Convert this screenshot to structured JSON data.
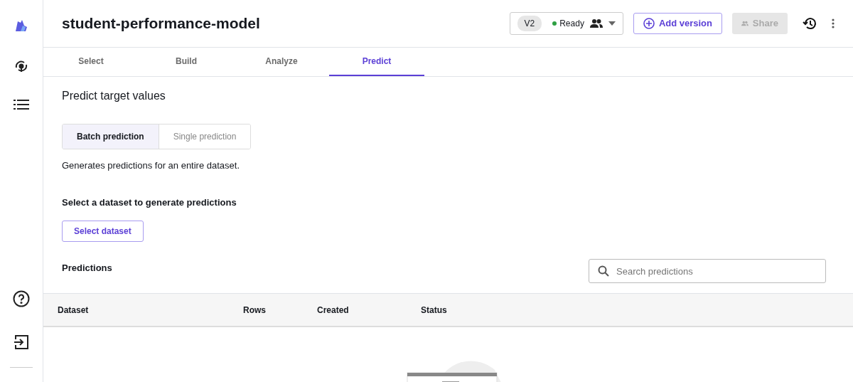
{
  "model": {
    "title": "student-performance-model",
    "version": "V2",
    "status": {
      "label": "Ready",
      "color": "#2ea043"
    }
  },
  "header_buttons": [
    {
      "label": "Add version",
      "kind": "outline",
      "disabled": false
    },
    {
      "label": "Share",
      "kind": "share",
      "disabled": true
    }
  ],
  "tabs": [
    {
      "label": "Select",
      "selected": false
    },
    {
      "label": "Build",
      "selected": false
    },
    {
      "label": "Analyze",
      "selected": false
    },
    {
      "label": "Predict",
      "selected": true
    }
  ],
  "heading": "Predict target values",
  "modes": [
    {
      "label": "Batch prediction",
      "selected": true
    },
    {
      "label": "Single prediction",
      "selected": false
    }
  ],
  "mode_description": "Generates predictions for an entire dataset.",
  "dataset_heading": "Select a dataset to generate predictions",
  "select_button": "Select dataset",
  "predictions": {
    "title": "Predictions",
    "search": {
      "placeholder": "Search predictions"
    },
    "columns": [
      "Dataset",
      "Rows",
      "Created",
      "Status"
    ]
  }
}
